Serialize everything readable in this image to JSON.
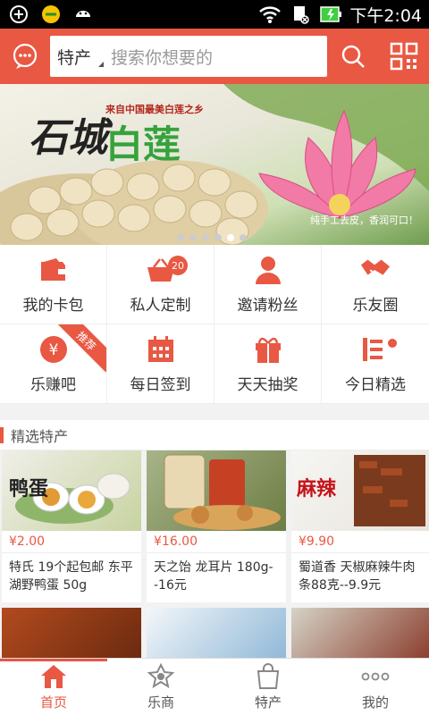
{
  "status": {
    "time": "下午2:04"
  },
  "header": {
    "search_category": "特产",
    "search_placeholder": "搜索你想要的"
  },
  "banner": {
    "subtitle": "来自中国最美白莲之乡",
    "title_part1": "石城",
    "title_part2": "白莲",
    "note": "纯手工去皮，香润可口！",
    "dots_count": 6,
    "active_dot": 5
  },
  "grid": [
    {
      "label": "我的卡包",
      "icon": "wallet-icon"
    },
    {
      "label": "私人定制",
      "icon": "basket-icon",
      "badge": "20"
    },
    {
      "label": "邀请粉丝",
      "icon": "person-icon"
    },
    {
      "label": "乐友圈",
      "icon": "handshake-icon"
    },
    {
      "label": "乐赚吧",
      "icon": "yen-coin-icon",
      "ribbon": "推荐"
    },
    {
      "label": "每日签到",
      "icon": "calendar-icon"
    },
    {
      "label": "天天抽奖",
      "icon": "gift-icon"
    },
    {
      "label": "今日精选",
      "icon": "list-icon"
    }
  ],
  "section": {
    "title": "精选特产"
  },
  "products": [
    {
      "price": "¥2.00",
      "desc": "特氏  19个起包邮 东平湖野鸭蛋  50g"
    },
    {
      "price": "¥16.00",
      "desc": "天之饴 龙耳片 180g--16元"
    },
    {
      "price": "¥9.90",
      "desc": "蜀道香 天椒麻辣牛肉条88克--9.9元"
    }
  ],
  "nav": [
    {
      "label": "首页",
      "icon": "home-icon",
      "active": true
    },
    {
      "label": "乐商",
      "icon": "shop-badge-icon"
    },
    {
      "label": "特产",
      "icon": "shopping-bag-icon"
    },
    {
      "label": "我的",
      "icon": "more-dots-icon"
    }
  ],
  "colors": {
    "accent": "#e85843",
    "badge": "#e85843"
  }
}
